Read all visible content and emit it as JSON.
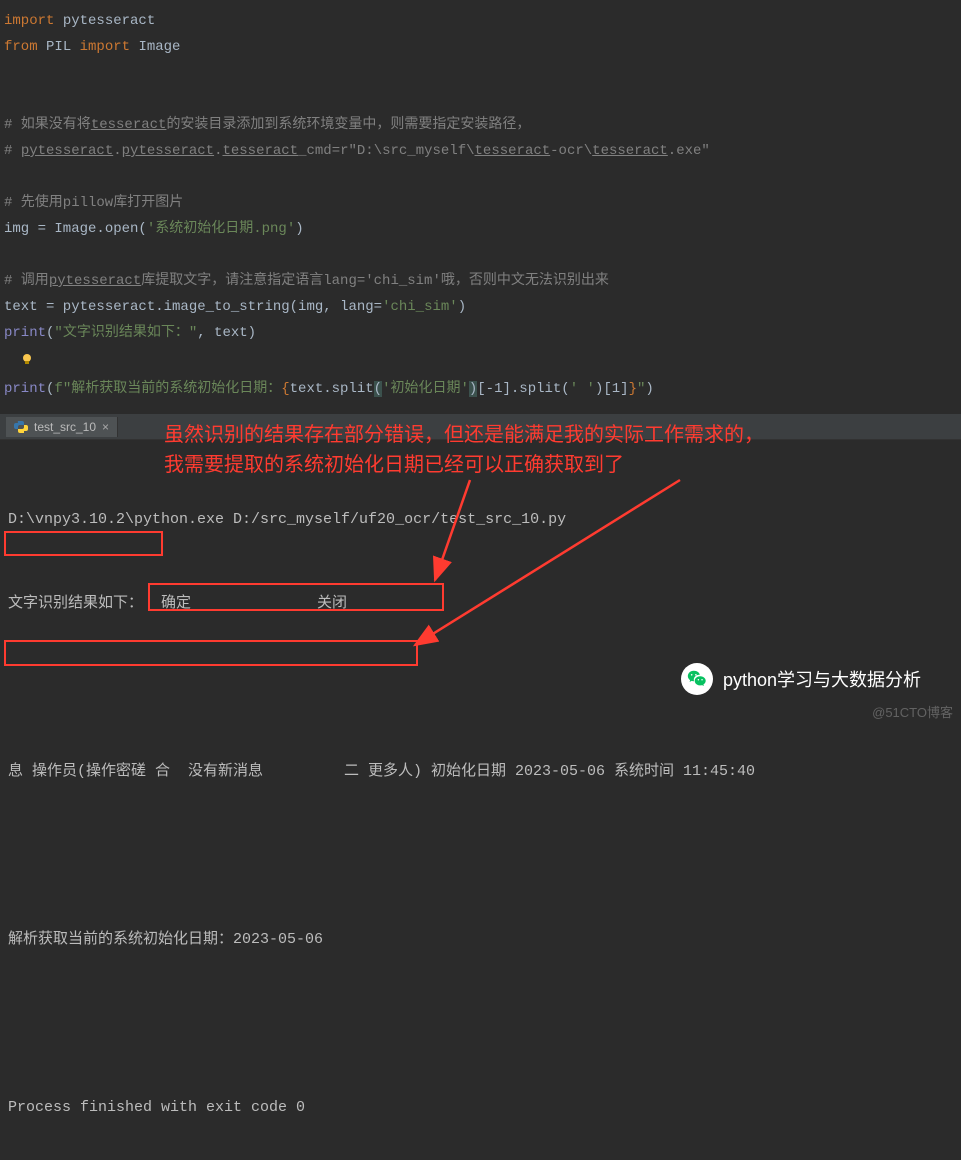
{
  "code": {
    "line1_import": "import",
    "line1_mod": " pytesseract",
    "line2_from": "from",
    "line2_pil": " PIL ",
    "line2_import": "import",
    "line2_image": " Image",
    "line5_comment_a": "# 如果没有将",
    "line5_tess": "tesseract",
    "line5_comment_b": "的安装目录添加到系统环境变量中，则需要指定安装路径，",
    "line6_a": "# ",
    "line6_pytess": "pytesseract",
    "line6_dot1": ".",
    "line6_pytess2": "pytesseract",
    "line6_dot2": ".",
    "line6_tesscmd": "tesseract",
    "line6_cmdeq": "_cmd=r\"D:\\src_myself\\",
    "line6_tess2": "tesseract",
    "line6_ocr": "-ocr\\",
    "line6_tess3": "tesseract",
    "line6_exe": ".exe\"",
    "line8_comment": "# 先使用pillow库打开图片",
    "line9_a": "img = Image.open(",
    "line9_str": "'系统初始化日期.png'",
    "line9_b": ")",
    "line11_comment_a": "# 调用",
    "line11_pytess": "pytesseract",
    "line11_comment_b": "库提取文字，请注意指定语言lang='chi_sim'哦，否则中文无法识别出来",
    "line12_a": "text = pytesseract.image_to_string(img, ",
    "line12_lang": "lang",
    "line12_eq": "=",
    "line12_str": "'chi_sim'",
    "line12_b": ")",
    "line13_print": "print",
    "line13_a": "(",
    "line13_str": "\"文字识别结果如下：\"",
    "line13_comma": ",",
    "line13_sep": " ",
    "line13_text": "text)",
    "line15_print": "print",
    "line15_a": "(",
    "line15_f": "f\"解析获取当前的系统初始化日期：",
    "line15_brace_open": "{",
    "line15_expr1": "text.split",
    "line15_paren_open": "(",
    "line15_s1": "'初始化日期'",
    "line15_paren_close": ")",
    "line15_idx1": "[-",
    "line15_num1": "1",
    "line15_idx1b": "].split(",
    "line15_s2": "' '",
    "line15_idx2a": ")[",
    "line15_num2": "1",
    "line15_idx2b": "]",
    "line15_brace_close": "}",
    "line15_end": "\"",
    "line15_close": ")"
  },
  "annotation": {
    "line1": "虽然识别的结果存在部分错误，但还是能满足我的实际工作需求的，",
    "line2": "我需要提取的系统初始化日期已经可以正确获取到了"
  },
  "tab": {
    "name": "test_src_10",
    "close": "×"
  },
  "console": {
    "cmd": "D:\\vnpy3.10.2\\python.exe D:/src_myself/uf20_ocr/test_src_10.py",
    "l1": "文字识别结果如下：  确定              关闭",
    "l3": "息 操作员(操作密磋 合  没有新消息         二 更多人) 初始化日期 2023-05-06 系统时间 11:45:40",
    "l5": "解析获取当前的系统初始化日期：2023-05-06",
    "exit": "Process finished with exit code 0"
  },
  "watermark": {
    "brand": "python学习与大数据分析",
    "site": "@51CTO博客"
  }
}
